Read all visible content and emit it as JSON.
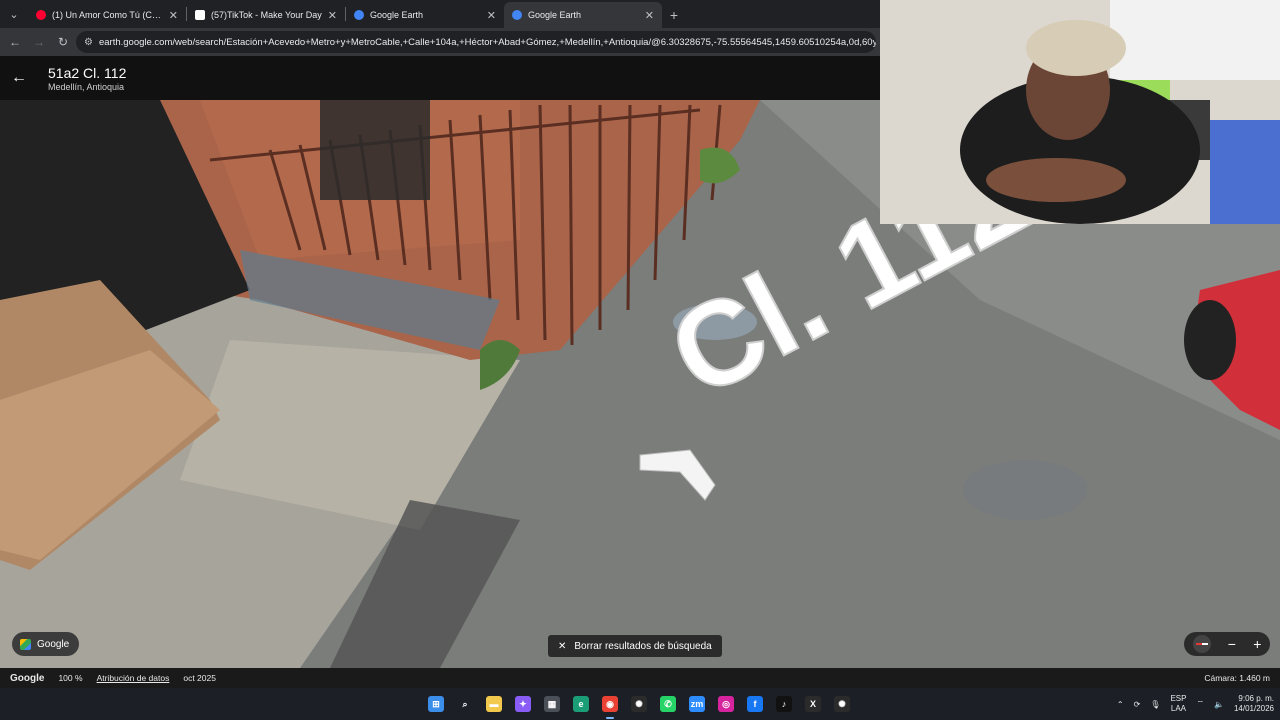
{
  "browser": {
    "tabs": [
      {
        "title": "(1) Un Amor Como Tú (Clean V",
        "icon": "youtube-icon",
        "color": "#ff0033"
      },
      {
        "title": "(57)TikTok - Make Your Day",
        "icon": "tiktok-icon",
        "color": "#ffffff"
      },
      {
        "title": "Google Earth",
        "icon": "google-earth-icon",
        "color": "#4285f4"
      },
      {
        "title": "Google Earth",
        "icon": "google-earth-icon",
        "color": "#4285f4",
        "active": true
      }
    ],
    "url": "earth.google.com/web/search/Estación+Acevedo+Metro+y+MetroCable,+Calle+104a,+Héctor+Abad+Gómez,+Medellín,+Antioquia/@6.30328675,-75.55564545,1459.60510254a,0d,60y,28"
  },
  "earth": {
    "place_name": "51a2 Cl. 112",
    "place_locality": "Medellín, Antioquia",
    "street_label": "Cl. 112",
    "google_chip": "Google",
    "clear_search": "Borrar resultados de búsqueda",
    "zoom_out": "−",
    "zoom_in": "+"
  },
  "status": {
    "logo": "Google",
    "zoom": "100 %",
    "attribution": "Atribución de datos",
    "date": "oct 2025",
    "camera": "Cámara: 1.460 m"
  },
  "taskbar": {
    "apps": [
      {
        "name": "windows-start-icon",
        "color": "#3b8eea",
        "glyph": "⊞"
      },
      {
        "name": "search-icon",
        "color": "transparent",
        "glyph": "⌕"
      },
      {
        "name": "file-explorer-icon",
        "color": "#f2c94c",
        "glyph": "▬"
      },
      {
        "name": "copilot-icon",
        "color": "#8a5cf6",
        "glyph": "✦"
      },
      {
        "name": "microsoft-store-icon",
        "color": "#4b4f57",
        "glyph": "▦"
      },
      {
        "name": "edge-icon",
        "color": "#1b9e77",
        "glyph": "e"
      },
      {
        "name": "chrome-icon",
        "color": "#e94235",
        "glyph": "◉",
        "active": true
      },
      {
        "name": "chatgpt-icon",
        "color": "#2b2b2b",
        "glyph": "✺"
      },
      {
        "name": "whatsapp-icon",
        "color": "#25d366",
        "glyph": "✆"
      },
      {
        "name": "zoom-icon",
        "color": "#2d8cff",
        "glyph": "zm"
      },
      {
        "name": "instagram-icon",
        "color": "#d6249f",
        "glyph": "◎"
      },
      {
        "name": "facebook-icon",
        "color": "#1877f2",
        "glyph": "f"
      },
      {
        "name": "tiktok-taskbar-icon",
        "color": "#111111",
        "glyph": "♪"
      },
      {
        "name": "excel-icon",
        "color": "#2b2b2b",
        "glyph": "X"
      },
      {
        "name": "chatgpt-desktop-icon",
        "color": "#2b2b2b",
        "glyph": "✺"
      }
    ],
    "lang_top": "ESP",
    "lang_bottom": "LAA",
    "time": "9:06 p. m.",
    "date": "14/01/2026"
  }
}
